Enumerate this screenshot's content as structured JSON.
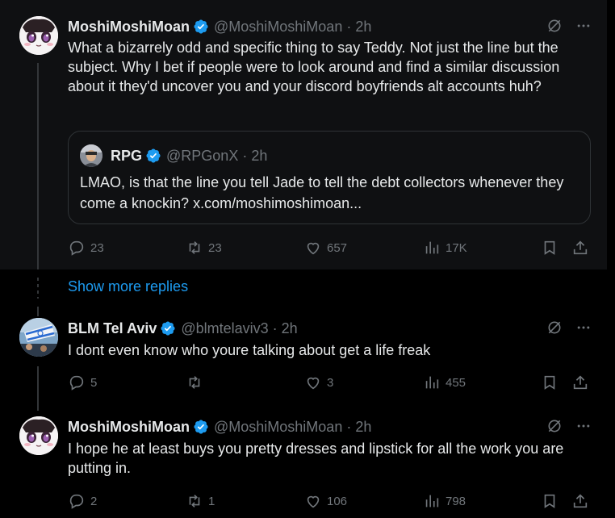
{
  "colors": {
    "background": "#000000",
    "panel": "#0f1012",
    "text": "#e7e9ea",
    "muted": "#71767b",
    "accent": "#1d9bf0",
    "border": "#2f3336"
  },
  "tweets": [
    {
      "name": "MoshiMoshiMoan",
      "handle": "@MoshiMoshiMoan",
      "time": "2h",
      "text": "What a bizarrely odd and specific thing to say Teddy.  Not just the line but the subject.  Why I bet if people were to look around and find a similar discussion about it they'd uncover you and your discord boyfriends alt accounts huh?",
      "quote": {
        "name": "RPG",
        "handle": "@RPGonX",
        "time": "2h",
        "text": "LMAO, is that the line you tell Jade to tell the debt collectors whenever they come a knockin? x.com/moshimoshimoan..."
      },
      "replies": "23",
      "reposts": "23",
      "likes": "657",
      "views": "17K"
    },
    {
      "name": "BLM Tel Aviv",
      "handle": "@blmtelaviv3",
      "time": "2h",
      "text": "I dont even know who youre talking about get a life freak",
      "replies": "5",
      "reposts": "",
      "likes": "3",
      "views": "455"
    },
    {
      "name": "MoshiMoshiMoan",
      "handle": "@MoshiMoshiMoan",
      "time": "2h",
      "text": "I hope he at least buys you pretty dresses and lipstick for all the work you are putting in.",
      "replies": "2",
      "reposts": "1",
      "likes": "106",
      "views": "798"
    }
  ],
  "show_more": "Show more replies",
  "separators": {
    "dot": "·"
  },
  "icons": [
    "verified-badge-icon",
    "grok-icon",
    "more-icon",
    "reply-icon",
    "repost-icon",
    "like-icon",
    "views-icon",
    "bookmark-icon",
    "share-icon"
  ]
}
